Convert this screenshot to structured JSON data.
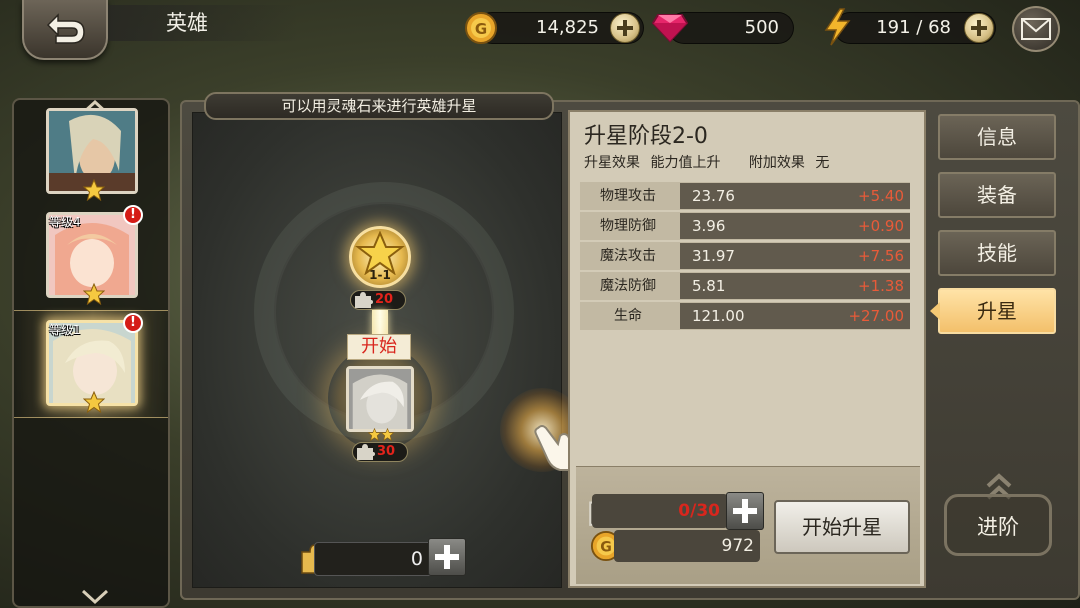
{
  "header": {
    "title": "英雄",
    "gold": "14,825",
    "gems": "500",
    "stamina": "191 / 68"
  },
  "hero_list": [
    {
      "level": "",
      "has_alert": false,
      "selected": false
    },
    {
      "level": "等级4",
      "has_alert": true,
      "selected": false
    },
    {
      "level": "等级1",
      "has_alert": true,
      "selected": true
    }
  ],
  "alert_symbol": "!",
  "hint": "可以用灵魂石来进行英雄升星",
  "tree": {
    "next_node_label": "1-1",
    "next_node_cost": "20",
    "start_tag": "开始",
    "current_node_cost": "30",
    "soul_stone_count": "0"
  },
  "stats": {
    "stage_title": "升星阶段2-0",
    "effect_label": "升星效果",
    "effect_value": "能力值上升",
    "extra_label": "附加效果",
    "extra_value": "无",
    "rows": [
      {
        "name": "物理攻击",
        "value": "23.76",
        "bonus": "+5.40"
      },
      {
        "name": "物理防御",
        "value": "3.96",
        "bonus": "+0.90"
      },
      {
        "name": "魔法攻击",
        "value": "31.97",
        "bonus": "+7.56"
      },
      {
        "name": "魔法防御",
        "value": "5.81",
        "bonus": "+1.38"
      },
      {
        "name": "生命",
        "value": "121.00",
        "bonus": "+27.00"
      }
    ],
    "piece_cost": "0/30",
    "gold_cost": "972",
    "start_button": "开始升星"
  },
  "tabs": [
    "信息",
    "装备",
    "技能",
    "升星"
  ],
  "active_tab": "升星",
  "advance_button": "进阶",
  "colors": {
    "accent_gold": "#f3c06b",
    "bonus_orange": "#e85b39",
    "cost_red": "#d8261d"
  },
  "icons": [
    "back-arrow-icon",
    "gold-coin-icon",
    "gem-icon",
    "lightning-icon",
    "mail-icon",
    "star-icon",
    "puzzle-piece-icon",
    "plus-icon",
    "chevron-up-icon",
    "chevron-down-icon",
    "hand-pointer-icon"
  ]
}
